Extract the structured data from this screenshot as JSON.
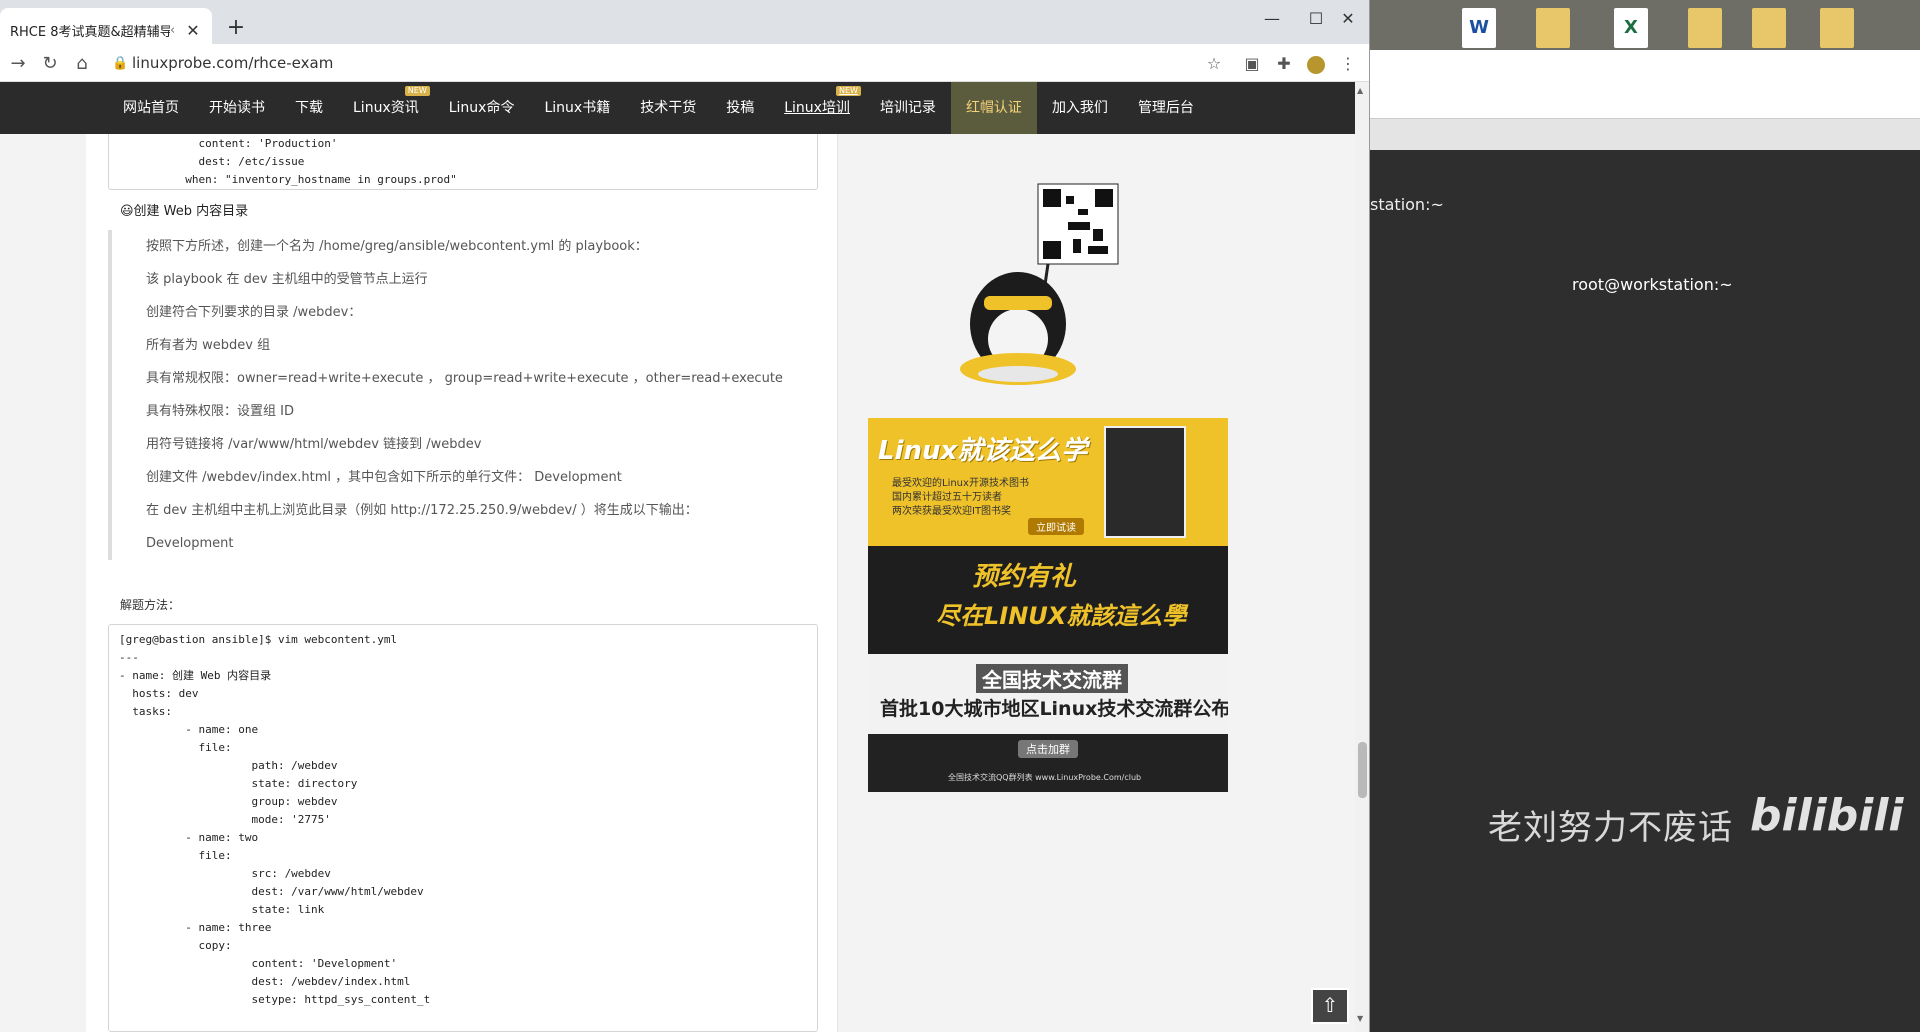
{
  "browser": {
    "tab_title": "RHCE 8考试真题&超精辅导 |",
    "tab_arrow": "‹",
    "tab_close": "✕",
    "new_tab": "+",
    "url": "linuxprobe.com/rhce-exam",
    "win_min": "—",
    "win_max": "☐",
    "win_close": "✕"
  },
  "site_nav": {
    "items": [
      {
        "label": "网站首页",
        "badge": ""
      },
      {
        "label": "开始读书",
        "badge": ""
      },
      {
        "label": "下载",
        "badge": ""
      },
      {
        "label": "Linux资讯",
        "badge": "NEW"
      },
      {
        "label": "Linux命令",
        "badge": ""
      },
      {
        "label": "Linux书籍",
        "badge": ""
      },
      {
        "label": "技术干货",
        "badge": ""
      },
      {
        "label": "投稿",
        "badge": ""
      },
      {
        "label": "Linux培训",
        "badge": "NEW"
      },
      {
        "label": "培训记录",
        "badge": ""
      },
      {
        "label": "红帽认证",
        "badge": ""
      },
      {
        "label": "加入我们",
        "badge": ""
      },
      {
        "label": "管理后台",
        "badge": ""
      }
    ]
  },
  "top_code": "            content: 'Production'\n            dest: /etc/issue\n          when: \"inventory_hostname in groups.prod\"",
  "section_title": "😃创建 Web 内容目录",
  "requirements": [
    "按照下方所述，创建一个名为 /home/greg/ansible/webcontent.yml 的 playbook：",
    "该 playbook 在 dev 主机组中的受管节点上运行",
    "创建符合下列要求的目录 /webdev：",
    "所有者为 webdev 组",
    "具有常规权限：owner=read+write+execute ， group=read+write+execute ，other=read+execute",
    "具有特殊权限：设置组 ID",
    "用符号链接将 /var/www/html/webdev 链接到 /webdev",
    "创建文件 /webdev/index.html ，其中包含如下所示的单行文件：  Development",
    "在 dev 主机组中主机上浏览此目录（例如 http://172.25.250.9/webdev/ ）将生成以下输出：",
    "Development"
  ],
  "solution_label": "解题方法：",
  "solution_code": "[greg@bastion ansible]$ vim webcontent.yml\n---\n- name: 创建 Web 内容目录\n  hosts: dev\n  tasks:\n          - name: one\n            file:\n                    path: /webdev\n                    state: directory\n                    group: webdev\n                    mode: '2775'\n          - name: two\n            file:\n                    src: /webdev\n                    dest: /var/www/html/webdev\n                    state: link\n          - name: three\n            copy:\n                    content: 'Development'\n                    dest: /webdev/index.html\n                    setype: httpd_sys_content_t",
  "ads": {
    "ad1_title": "Linux就该这么学",
    "ad1_lines": [
      "最受欢迎的Linux开源技术图书",
      "国内累计超过五十万读者",
      "两次荣获最受欢迎IT图书奖"
    ],
    "ad1_button": "立即试读",
    "ad2_title": "预约有礼",
    "ad2_subtitle": "尽在LINUX就該這么學",
    "ad3_title": "全国技术交流群",
    "ad3_subtitle": "首批10大城市地区Linux技术交流群公布",
    "ad3_button": "点击加群",
    "ad3_footer": "全国技术交流QQ群列表  www.LinuxProbe.Com/club"
  },
  "desktop": {
    "icons": [
      {
        "label": "W",
        "type": "word"
      },
      {
        "label": "",
        "type": "folder"
      },
      {
        "label": "X",
        "type": "excel"
      },
      {
        "label": "",
        "type": "folder"
      },
      {
        "label": "",
        "type": "folder"
      },
      {
        "label": "",
        "type": "folder"
      }
    ]
  },
  "terminal": {
    "tab_left": "station:~",
    "tab_right": "root@workstation:~"
  },
  "watermark": {
    "text": "老刘努力不废话",
    "logo": "bilibili"
  },
  "colors": {
    "nav_bg": "#2b2b2b",
    "nav_active": "#5b5b3e",
    "ad_yellow": "#f0c22a"
  }
}
